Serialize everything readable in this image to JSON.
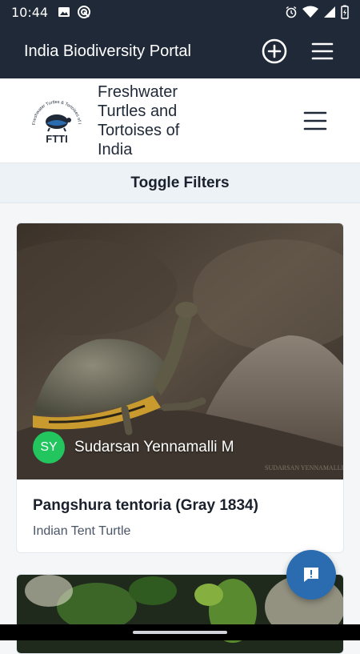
{
  "status": {
    "time": "10:44"
  },
  "appbar": {
    "title": "India Biodiversity Portal",
    "add_icon": "plus-circle-icon",
    "menu_icon": "hamburger-icon"
  },
  "brand": {
    "name": "Freshwater Turtles and Tortoises of India",
    "logo_text": "FTTI",
    "logo_arc_text": "Freshwater Turtles & Tortoises of India"
  },
  "filters": {
    "label": "Toggle Filters"
  },
  "cards": [
    {
      "user_initials": "SY",
      "user_name": "Sudarsan Yennamalli M",
      "scientific_name": "Pangshura tentoria (Gray 1834)",
      "common_name": "Indian Tent Turtle",
      "watermark": "SUDARSAN YENNAMALLI M"
    }
  ],
  "colors": {
    "appbar": "#1f2937",
    "avatar": "#22c55e",
    "fab": "#2b6cb0"
  }
}
